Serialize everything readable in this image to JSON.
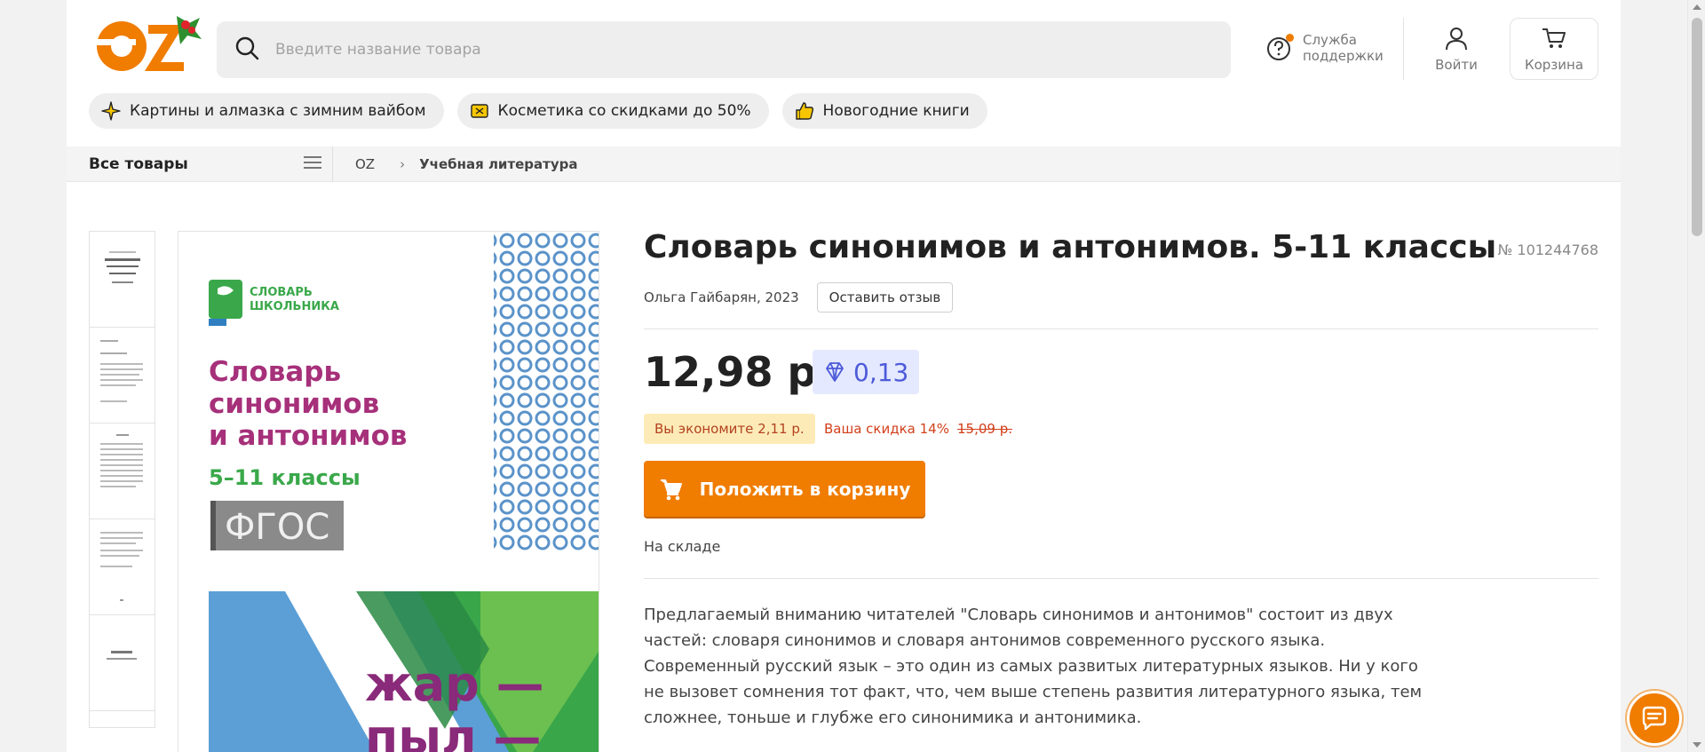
{
  "header": {
    "logo_text": "OZ",
    "search_placeholder": "Введите название товара",
    "support_label_1": "Служба",
    "support_label_2": "поддержки",
    "login_label": "Войти",
    "cart_label": "Корзина"
  },
  "chips": [
    {
      "label": "Картины и алмазка с зимним вайбом",
      "icon": "sparkle-icon"
    },
    {
      "label": "Косметика со скидками до 50%",
      "icon": "ticket-icon"
    },
    {
      "label": "Новогодние книги",
      "icon": "thumbs-up-icon"
    }
  ],
  "nav": {
    "all_goods": "Все товары",
    "breadcrumb": [
      "OZ",
      "Учебная литература"
    ],
    "breadcrumb_sep": "›"
  },
  "cover": {
    "series_line1": "СЛОВАРЬ",
    "series_line2": "ШКОЛЬНИКА",
    "title_line1": "Словарь",
    "title_line2": "синонимов",
    "title_line3": "и антонимов",
    "grades": "5–11 классы",
    "standard": "ФГОС",
    "word1": "жар —",
    "word2": "пыл —"
  },
  "product": {
    "title": "Словарь синонимов и антонимов. 5-11 классы",
    "number": "№ 101244768",
    "author_year": "Ольга Гайбарян, 2023",
    "review_button": "Оставить отзыв",
    "price": "12,98 р.",
    "bonus": "0,13",
    "savings": "Вы экономите 2,11 р.",
    "discount": "Ваша скидка 14%",
    "old_price": "15,09 р.",
    "buy_button": "Положить в корзину",
    "stock": "На складе",
    "description": "Предлагаемый вниманию читателей \"Словарь синонимов и антонимов\" состоит из двух частей: словаря синонимов и словаря антонимов современного русского языка. Современный русский язык – это один из самых развитых литературных языков. Ни у кого не вызовет сомнения тот факт, что, чем выше степень развития литературного языка, тем сложнее, тоньше и глубже его синонимика и антонимика."
  },
  "colors": {
    "accent": "#f07c00",
    "bonus_bg": "#e4e9ff",
    "bonus_text": "#4d5bd9",
    "discount": "#d2401b",
    "savings_bg": "#fdebb7"
  }
}
